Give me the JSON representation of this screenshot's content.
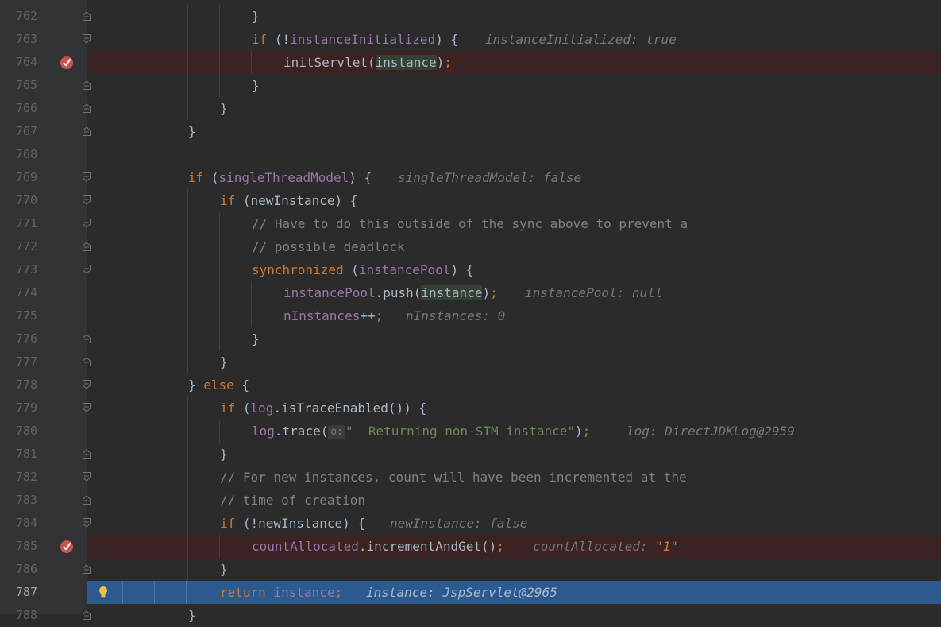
{
  "editor": {
    "line_numbers": [
      "762",
      "763",
      "764",
      "765",
      "766",
      "767",
      "768",
      "769",
      "770",
      "771",
      "772",
      "773",
      "774",
      "775",
      "776",
      "777",
      "778",
      "779",
      "780",
      "781",
      "782",
      "783",
      "784",
      "785",
      "786",
      "787",
      "788"
    ],
    "l762": {
      "brace": "}"
    },
    "l763": {
      "kw_if": "if",
      "open": " (!",
      "var": "instanceInitialized",
      "close": ") {",
      "inline": "instanceInitialized: true"
    },
    "l764": {
      "method": "initServlet(",
      "arg": "instance",
      "close": ")",
      "semi": ";"
    },
    "l765": {
      "brace": "}"
    },
    "l766": {
      "brace": "}"
    },
    "l767": {
      "brace": "}"
    },
    "l769": {
      "kw_if": "if",
      "open": " (",
      "var": "singleThreadModel",
      "close": ") {",
      "inline": "singleThreadModel: false"
    },
    "l770": {
      "kw_if": "if",
      "rest": " (newInstance) {"
    },
    "l771": {
      "comment": "// Have to do this outside of the sync above to prevent a"
    },
    "l772": {
      "comment": "// possible deadlock"
    },
    "l773": {
      "kw": "synchronized",
      "open": " (",
      "var": "instancePool",
      "close": ") {"
    },
    "l774": {
      "var": "instancePool",
      "method": ".push(",
      "arg": "instance",
      "close": ")",
      "semi": ";",
      "inline": "instancePool: null"
    },
    "l775": {
      "var": "nInstances",
      "op": "++",
      "semi": ";",
      "inline": "nInstances: 0"
    },
    "l776": {
      "brace": "}"
    },
    "l777": {
      "brace": "}"
    },
    "l778": {
      "open": "} ",
      "kw_else": "else",
      "close": " {"
    },
    "l779": {
      "kw_if": "if",
      "open": " (",
      "var": "log",
      "rest": ".isTraceEnabled()) {"
    },
    "l780": {
      "var": "log",
      "method": ".trace(",
      "hint": "o:",
      "str": "\"  Returning non-STM instance\"",
      "close": ")",
      "semi": ";",
      "inline": "log: DirectJDKLog@2959"
    },
    "l781": {
      "brace": "}"
    },
    "l782": {
      "comment": "// For new instances, count will have been incremented at the"
    },
    "l783": {
      "comment": "// time of creation"
    },
    "l784": {
      "kw_if": "if",
      "rest": " (!newInstance) {",
      "inline": "newInstance: false"
    },
    "l785": {
      "var": "countAllocated",
      "method": ".incrementAndGet()",
      "semi": ";",
      "inline": "countAllocated: ",
      "inline_val": "\"1\""
    },
    "l786": {
      "brace": "}"
    },
    "l787": {
      "kw": "return",
      "var": "instance",
      "semi": ";",
      "inline": "instance: JspServlet@2965"
    },
    "l788": {
      "brace": "}"
    }
  },
  "colors": {
    "background": "#2b2b2b",
    "gutter": "#313335",
    "keyword": "#cc7832",
    "field": "#9876aa",
    "comment": "#808080",
    "string": "#6a8759",
    "breakpoint_line": "#3b2323",
    "execution_line": "#2d5a8e",
    "breakpoint": "#c75450"
  },
  "icons": {
    "breakpoint": "breakpoint-verified-icon",
    "fold": "fold-marker-icon",
    "intention": "lightbulb-icon"
  }
}
